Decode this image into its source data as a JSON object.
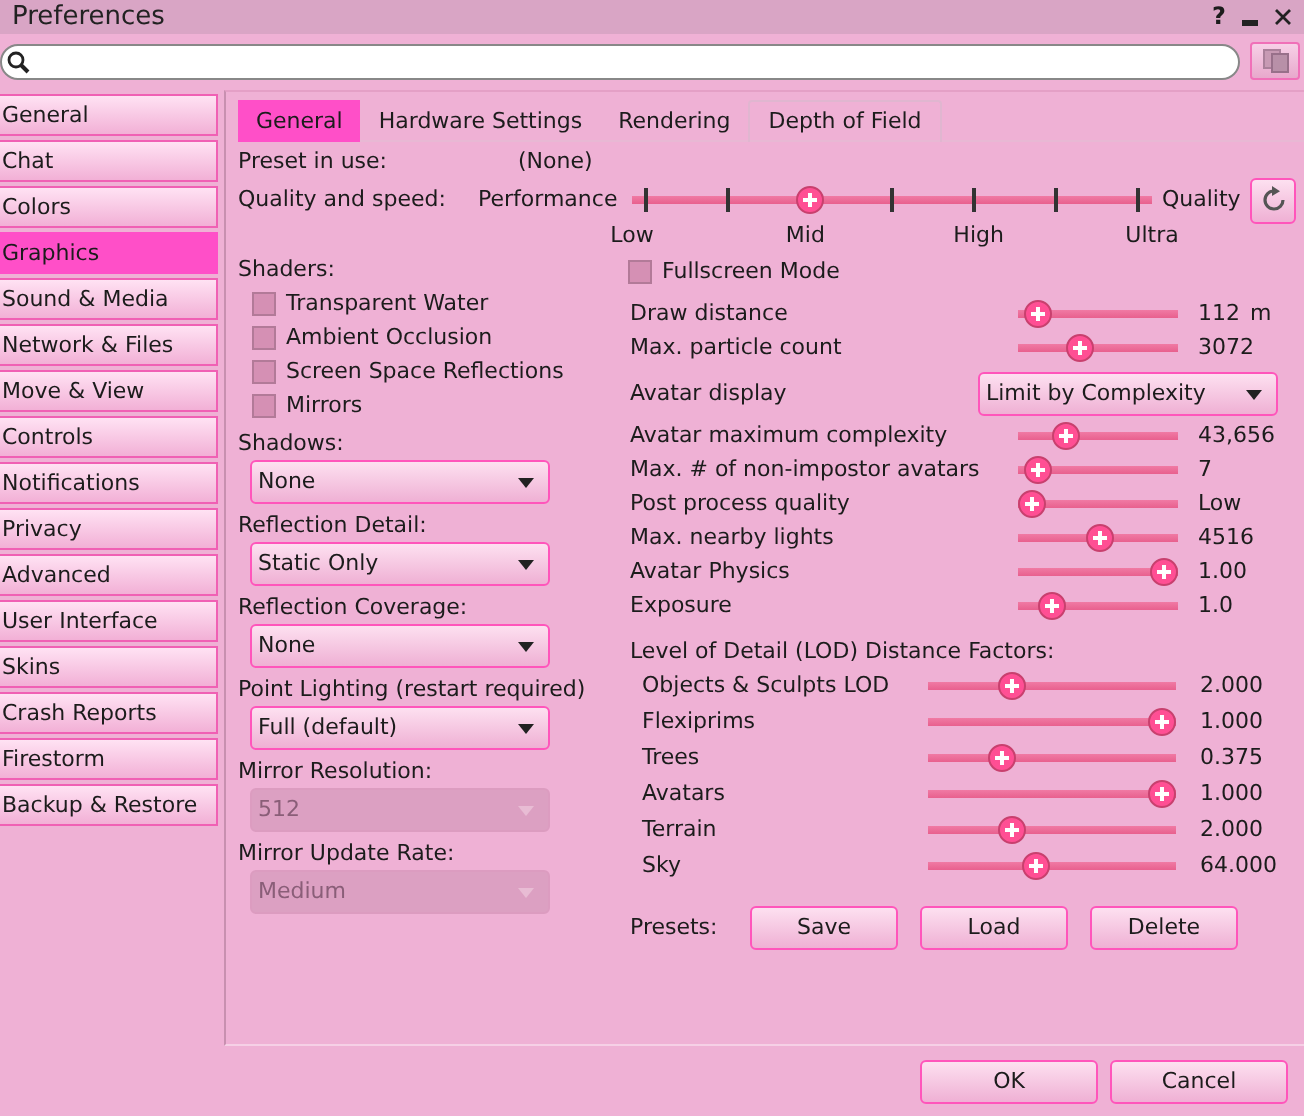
{
  "window": {
    "title": "Preferences",
    "help": "?"
  },
  "sidebar": {
    "items": [
      {
        "label": "General",
        "selected": false
      },
      {
        "label": "Chat",
        "selected": false
      },
      {
        "label": "Colors",
        "selected": false
      },
      {
        "label": "Graphics",
        "selected": true
      },
      {
        "label": "Sound & Media",
        "selected": false
      },
      {
        "label": "Network & Files",
        "selected": false
      },
      {
        "label": "Move & View",
        "selected": false
      },
      {
        "label": "Controls",
        "selected": false
      },
      {
        "label": "Notifications",
        "selected": false
      },
      {
        "label": "Privacy",
        "selected": false
      },
      {
        "label": "Advanced",
        "selected": false
      },
      {
        "label": "User Interface",
        "selected": false
      },
      {
        "label": "Skins",
        "selected": false
      },
      {
        "label": "Crash Reports",
        "selected": false
      },
      {
        "label": "Firestorm",
        "selected": false
      },
      {
        "label": "Backup & Restore",
        "selected": false
      }
    ]
  },
  "tabs": [
    {
      "label": "General",
      "selected": true
    },
    {
      "label": "Hardware Settings",
      "selected": false
    },
    {
      "label": "Rendering",
      "selected": false
    },
    {
      "label": "Depth of Field",
      "selected": false
    }
  ],
  "preset": {
    "label": "Preset in use:",
    "value": "(None)"
  },
  "quality": {
    "label": "Quality and speed:",
    "low_end": "Performance",
    "high_end": "Quality",
    "level": 0.333,
    "tick_labels": [
      "Low",
      "Mid",
      "High",
      "Ultra"
    ]
  },
  "shaders": {
    "label": "Shaders:",
    "items": [
      {
        "label": "Transparent Water",
        "checked": false
      },
      {
        "label": "Ambient Occlusion",
        "checked": false
      },
      {
        "label": "Screen Space Reflections",
        "checked": false
      },
      {
        "label": "Mirrors",
        "checked": false
      }
    ]
  },
  "left_dropdowns": [
    {
      "label": "Shadows:",
      "value": "None",
      "disabled": false
    },
    {
      "label": "Reflection Detail:",
      "value": "Static Only",
      "disabled": false
    },
    {
      "label": "Reflection Coverage:",
      "value": "None",
      "disabled": false
    },
    {
      "label": "Point Lighting (restart required)",
      "value": "Full (default)",
      "disabled": false
    },
    {
      "label": "Mirror Resolution:",
      "value": "512",
      "disabled": true
    },
    {
      "label": "Mirror Update Rate:",
      "value": "Medium",
      "disabled": true
    }
  ],
  "fullscreen": {
    "label": "Fullscreen Mode",
    "checked": false
  },
  "settings": [
    {
      "kind": "slider",
      "label": "Draw distance",
      "level": 0.05,
      "reading": "112",
      "unit": "m"
    },
    {
      "kind": "slider",
      "label": "Max. particle count",
      "level": 0.36,
      "reading": "3072"
    },
    {
      "kind": "dropdown",
      "label": "Avatar display",
      "value": "Limit by Complexity"
    },
    {
      "kind": "slider",
      "label": "Avatar maximum complexity",
      "level": 0.26,
      "reading": "43,656"
    },
    {
      "kind": "slider",
      "label": "Max. # of non-impostor avatars",
      "level": 0.05,
      "reading": "7"
    },
    {
      "kind": "slider",
      "label": "Post process quality",
      "level": 0,
      "reading": "Low"
    },
    {
      "kind": "slider",
      "label": "Max. nearby lights",
      "level": 0.52,
      "reading": "4516"
    },
    {
      "kind": "slider",
      "label": "Avatar Physics",
      "level": 1,
      "reading": "1.00"
    },
    {
      "kind": "slider",
      "label": "Exposure",
      "level": 0.15,
      "reading": "1.0"
    }
  ],
  "lod": {
    "title": "Level of Detail (LOD) Distance Factors:",
    "items": [
      {
        "label": "Objects & Sculpts LOD",
        "level": 0.32,
        "reading": "2.000"
      },
      {
        "label": "Flexiprims",
        "level": 1,
        "reading": "1.000"
      },
      {
        "label": "Trees",
        "level": 0.27,
        "reading": "0.375"
      },
      {
        "label": "Avatars",
        "level": 1,
        "reading": "1.000"
      },
      {
        "label": "Terrain",
        "level": 0.32,
        "reading": "2.000"
      },
      {
        "label": "Sky",
        "level": 0.43,
        "reading": "64.000"
      }
    ]
  },
  "presets": {
    "label": "Presets:",
    "buttons": [
      "Save",
      "Load",
      "Delete"
    ]
  },
  "footer_buttons": [
    "OK",
    "Cancel"
  ]
}
